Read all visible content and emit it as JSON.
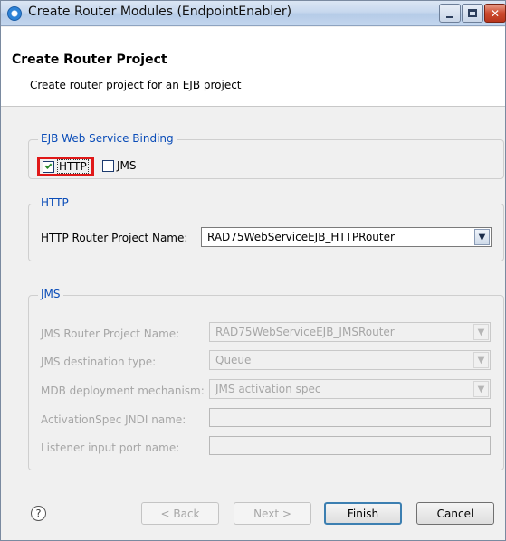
{
  "window": {
    "title": "Create Router Modules (EndpointEnabler)"
  },
  "banner": {
    "title": "Create Router Project",
    "description": "Create router project for an EJB project"
  },
  "binding_group": {
    "legend": "EJB Web Service Binding",
    "http_label": "HTTP",
    "http_checked": true,
    "jms_label": "JMS",
    "jms_checked": false
  },
  "http_group": {
    "legend": "HTTP",
    "project_name_label": "HTTP Router Project Name:",
    "project_name_value": "RAD75WebServiceEJB_HTTPRouter"
  },
  "jms_group": {
    "legend": "JMS",
    "project_name_label": "JMS Router Project Name:",
    "project_name_value": "RAD75WebServiceEJB_JMSRouter",
    "destination_type_label": "JMS destination type:",
    "destination_type_value": "Queue",
    "mdb_mechanism_label": "MDB deployment mechanism:",
    "mdb_mechanism_value": "JMS activation spec",
    "activation_spec_label": "ActivationSpec JNDI name:",
    "listener_port_label": "Listener input port name:"
  },
  "footer": {
    "help_glyph": "?",
    "back_label": "< Back",
    "next_label": "Next >",
    "finish_label": "Finish",
    "cancel_label": "Cancel"
  },
  "colors": {
    "highlight_box": "#e01818",
    "legend_text": "#0b4db8",
    "disabled_text": "#a6a6a6"
  }
}
